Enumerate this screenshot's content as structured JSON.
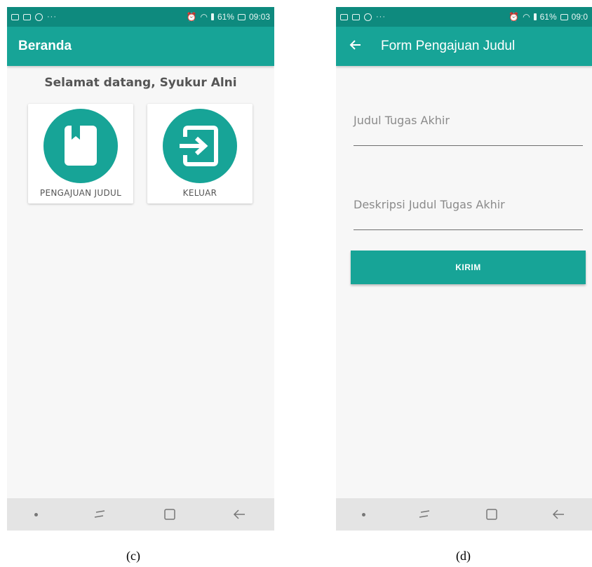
{
  "screen_c": {
    "status": {
      "dots": "···",
      "battery": "61%",
      "time": "09:03"
    },
    "appbar": {
      "title": "Beranda"
    },
    "welcome": "Selamat datang, Syukur Alni",
    "menu": [
      {
        "label": "PENGAJUAN JUDUL",
        "icon": "bookmark-book-icon"
      },
      {
        "label": "KELUAR",
        "icon": "exit-icon"
      }
    ]
  },
  "screen_d": {
    "status": {
      "dots": "···",
      "battery": "61%",
      "time": "09:0"
    },
    "appbar": {
      "title": "Form Pengajuan Judul",
      "back_icon": "back-arrow-icon"
    },
    "fields": {
      "judul": {
        "placeholder": "Judul Tugas Akhir",
        "value": ""
      },
      "deskripsi": {
        "placeholder": "Deskripsi Judul Tugas Akhir",
        "value": ""
      }
    },
    "submit_label": "KIRIM"
  },
  "captions": {
    "c": "(c)",
    "d": "(d)"
  },
  "colors": {
    "primary": "#17a497",
    "status_bar": "#0e8a7e",
    "background": "#f7f7f7"
  }
}
